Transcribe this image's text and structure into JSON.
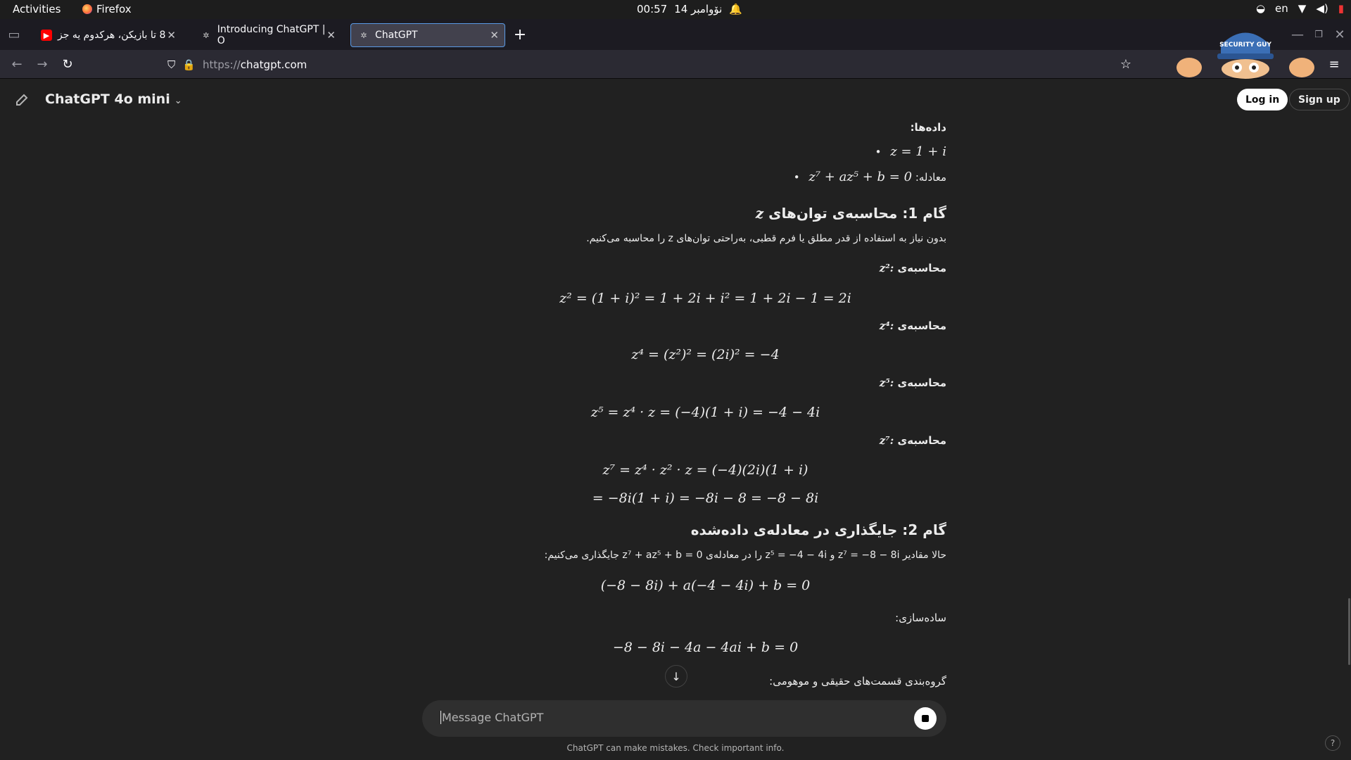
{
  "os_bar": {
    "activities": "Activities",
    "app": "Firefox",
    "clock_time": "00:57",
    "clock_date": "14 نۆوامبر",
    "lang": "en"
  },
  "tabs": [
    {
      "label": "8 تا بازیکن، هرکدوم یه جز",
      "favicon": "youtube-icon"
    },
    {
      "label": "Introducing ChatGPT | O",
      "favicon": "openai-icon"
    },
    {
      "label": "ChatGPT",
      "favicon": "openai-icon",
      "active": true
    }
  ],
  "url": {
    "scheme": "https://",
    "host": "chatgpt.com"
  },
  "header": {
    "model": "ChatGPT 4o mini",
    "login": "Log in",
    "signup": "Sign up"
  },
  "content": {
    "given_heading": "داده‌ها:",
    "given_1": "z = 1 + i",
    "given_2_label": "معادله:",
    "given_2_eq": "z⁷ + az⁵ + b = 0",
    "step1_title": "گام 1: محاسبه‌ی توان‌های",
    "step1_title_var": "z",
    "step1_desc": "بدون نیاز به استفاده از قدر مطلق یا فرم قطبی، به‌راحتی توان‌های z را محاسبه می‌کنیم.",
    "calc_z2_label": "محاسبه‌ی",
    "calc_z2_var": "z²:",
    "eq_z2": "z² = (1 + i)² = 1 + 2i + i² = 1 + 2i − 1 = 2i",
    "calc_z4_var": "z⁴:",
    "eq_z4": "z⁴ = (z²)² = (2i)² = −4",
    "calc_z5_var": "z⁵:",
    "eq_z5": "z⁵ = z⁴ · z = (−4)(1 + i) = −4 − 4i",
    "calc_z7_var": "z⁷:",
    "eq_z7a": "z⁷ = z⁴ · z² · z = (−4)(2i)(1 + i)",
    "eq_z7b": "= −8i(1 + i) = −8i − 8 = −8 − 8i",
    "step2_title": "گام 2: جایگذاری در معادله‌ی داده‌شده",
    "step2_desc": "حالا مقادیر z⁷ = −8 − 8i و z⁵ = −4 − 4i را در معادله‌ی z⁷ + az⁵ + b = 0 جایگذاری می‌کنیم:",
    "eq_sub": "(−8 − 8i) + a(−4 − 4i) + b = 0",
    "simplify_label": "ساده‌سازی:",
    "eq_simplified": "−8 − 8i − 4a − 4ai + b = 0",
    "group_label": "گروه‌بندی قسمت‌های حقیقی و موهومی:"
  },
  "composer": {
    "placeholder": "Message ChatGPT",
    "disclaimer": "ChatGPT can make mistakes. Check important info."
  },
  "mascot_text": "SECURITY GUY"
}
